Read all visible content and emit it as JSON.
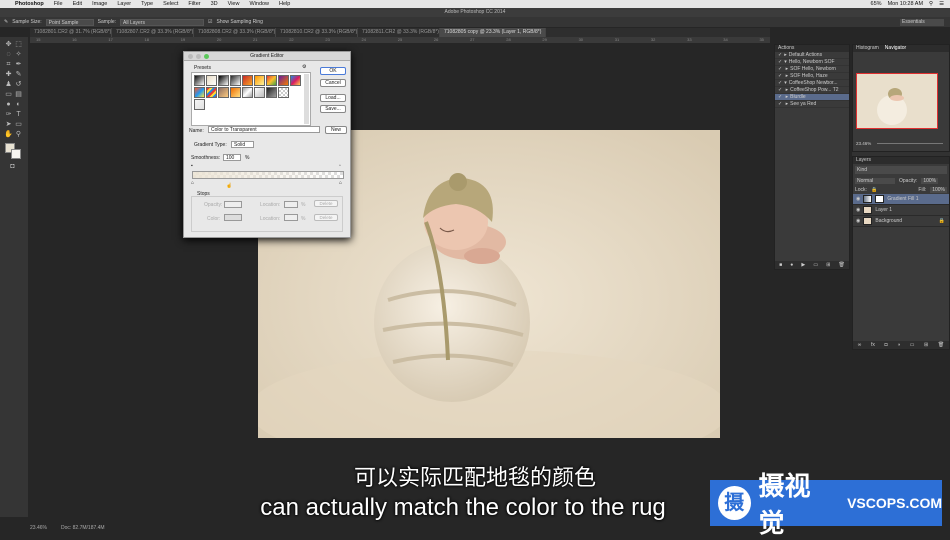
{
  "menubar": {
    "app": "Photoshop",
    "items": [
      "File",
      "Edit",
      "Image",
      "Layer",
      "Type",
      "Select",
      "Filter",
      "3D",
      "View",
      "Window",
      "Help"
    ],
    "zoom_status": "65%",
    "time": "Mon 10:28 AM"
  },
  "window_title": "Adobe Photoshop CC 2014",
  "options": {
    "sample_size_label": "Sample Size:",
    "sample_size": "Point Sample",
    "sample_label": "Sample:",
    "sample": "All Layers",
    "show_ring": "Show Sampling Ring",
    "workspace": "Essentials"
  },
  "doc_tabs": [
    "71082801.CR2 @ 31.7% (RGB/8*)",
    "71082807.CR2 @ 33.3% (RGB/8*)",
    "71082808.CR2 @ 33.3% (RGB/8*)",
    "71082810.CR2 @ 33.3% (RGB/8*)",
    "71082811.CR2 @ 33.3% (RGB/8*)",
    "71082805 copy @ 23.3% (Layer 1, RGB/8*)"
  ],
  "ruler_ticks": [
    "15",
    "16",
    "17",
    "18",
    "19",
    "20",
    "21",
    "22",
    "23",
    "24",
    "25",
    "26",
    "27",
    "28",
    "29",
    "30",
    "31",
    "32",
    "33",
    "34",
    "35"
  ],
  "status": {
    "zoom": "23.46%",
    "doc": "Doc: 82.7M/187.4M"
  },
  "actions": {
    "title": "Actions",
    "rows": [
      "Default Actions",
      "Hello, Newborn SOF",
      "SOF Hello, Newborn",
      "SOF Hello, Haze",
      "CoffeeShop Newbor...",
      "CoffeeShop Pow... T2",
      "Blurdle",
      "See ya Red"
    ]
  },
  "navigator": {
    "tabs": [
      "Histogram",
      "Navigator"
    ],
    "zoom": "23.46%"
  },
  "layers": {
    "title": "Layers",
    "kind": "Kind",
    "blend": "Normal",
    "opacity_label": "Opacity:",
    "opacity": "100%",
    "lock_label": "Lock:",
    "fill_label": "Fill:",
    "fill": "100%",
    "rows": [
      "Gradient Fill 1",
      "Layer 1",
      "Background"
    ]
  },
  "dialog": {
    "title": "Gradient Editor",
    "presets_label": "Presets",
    "ok": "OK",
    "cancel": "Cancel",
    "load": "Load...",
    "save": "Save...",
    "name_label": "Name:",
    "name_value": "Color to Transparent",
    "new": "New",
    "type_label": "Gradient Type:",
    "type_value": "Solid",
    "smooth_label": "Smoothness:",
    "smooth_value": "100",
    "pct": "%",
    "stops_label": "Stops",
    "opacity_label": "Opacity:",
    "color_label": "Color:",
    "location_label": "Location:",
    "delete": "Delete"
  },
  "subtitles": {
    "cn": "可以实际匹配地毯的颜色",
    "en": "can actually match the color to the rug"
  },
  "watermark": {
    "mark": "摄",
    "cn": "摄视觉",
    "en": "VSCOPS.COM"
  },
  "colors": {
    "accent": "#2d6fd6",
    "selection": "#5a6b8c",
    "nav_frame": "#e03030"
  }
}
